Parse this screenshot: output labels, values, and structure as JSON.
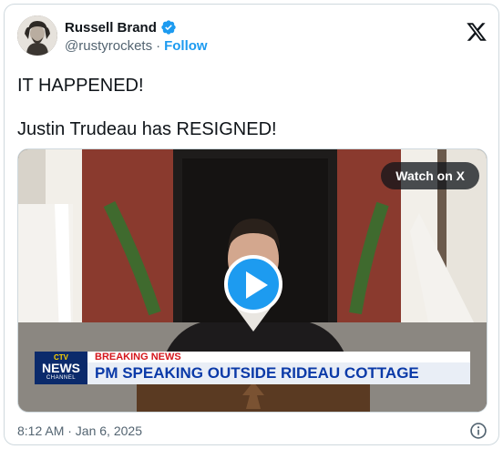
{
  "author": {
    "display_name": "Russell Brand",
    "handle": "@rustyrockets",
    "separator": "·",
    "follow_label": "Follow",
    "verified_color": "#1d9bf0"
  },
  "tweet": {
    "lines": [
      "IT HAPPENED!",
      "Justin Trudeau has RESIGNED!"
    ]
  },
  "media": {
    "watch_label": "Watch on X",
    "lower_third": {
      "logo_ctv": "CTV",
      "logo_news": "NEWS",
      "logo_channel": "CHANNEL",
      "breaking": "BREAKING NEWS",
      "headline": "PM SPEAKING OUTSIDE RIDEAU COTTAGE"
    },
    "play_icon": "play-icon"
  },
  "footer": {
    "timestamp": "8:12 AM · Jan 6, 2025",
    "info_icon": "info-icon"
  },
  "colors": {
    "accent": "#1d9bf0",
    "text_primary": "#0f1419",
    "text_secondary": "#536471",
    "breaking_red": "#d4161c",
    "headline_blue": "#0b3aa8"
  }
}
